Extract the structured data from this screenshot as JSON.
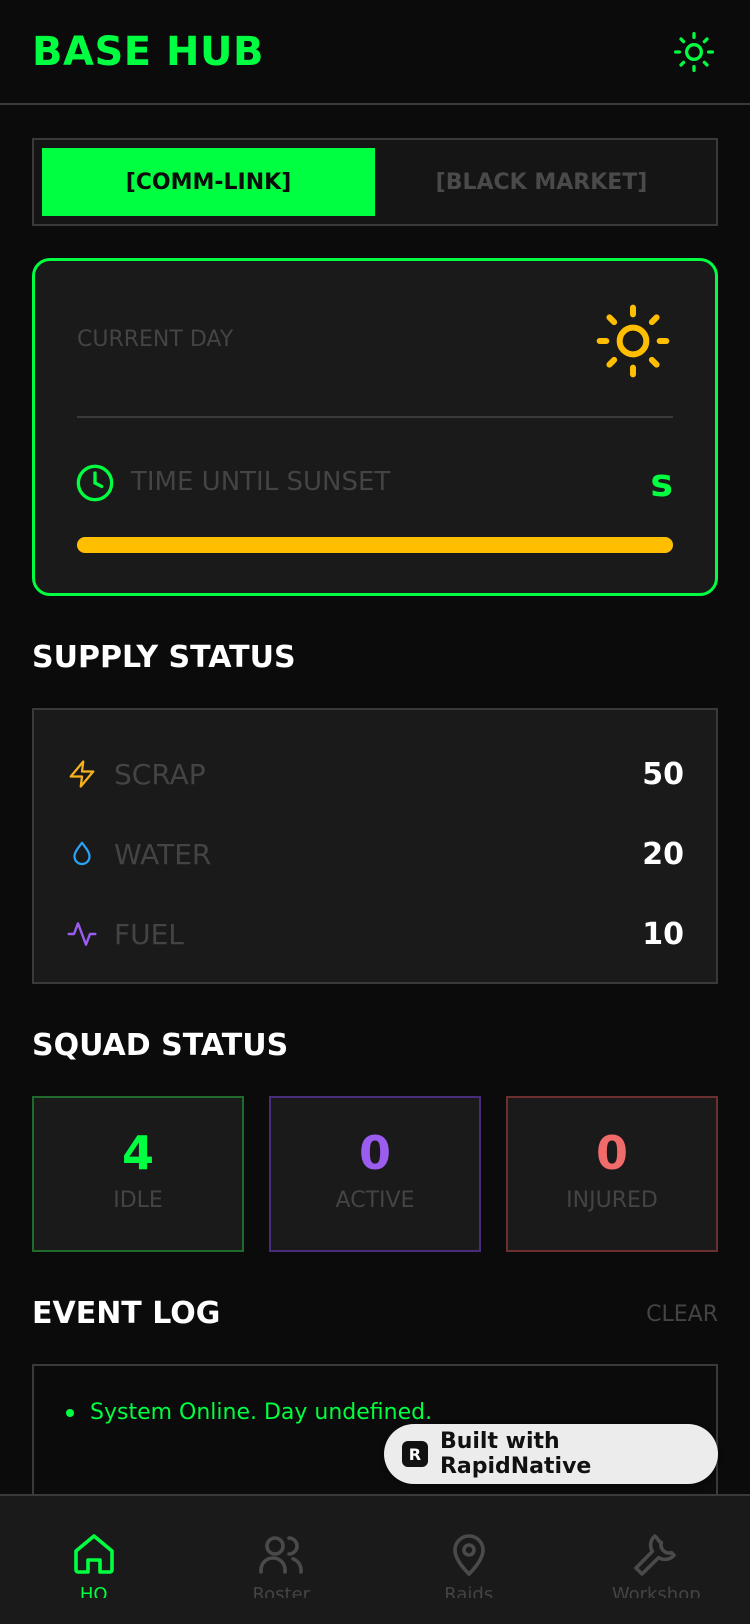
{
  "header": {
    "title": "BASE HUB",
    "theme_icon": "sun-icon"
  },
  "tabs": [
    {
      "label": "[COMM-LINK]",
      "active": true
    },
    {
      "label": "[BLACK MARKET]",
      "active": false
    }
  ],
  "day_card": {
    "current_day_label": "CURRENT DAY",
    "sunset_label": "TIME UNTIL SUNSET",
    "sunset_value": "s",
    "progress_percent": 100
  },
  "supply": {
    "title": "SUPPLY STATUS",
    "items": [
      {
        "label": "SCRAP",
        "value": "50",
        "icon": "lightning-icon",
        "color": "#f5b21b"
      },
      {
        "label": "WATER",
        "value": "20",
        "icon": "droplet-icon",
        "color": "#29a3f5"
      },
      {
        "label": "FUEL",
        "value": "10",
        "icon": "activity-icon",
        "color": "#9b5cf0"
      }
    ]
  },
  "squad": {
    "title": "SQUAD STATUS",
    "items": [
      {
        "value": "4",
        "label": "IDLE",
        "color": "#00ff40",
        "border": "#1f6b2e"
      },
      {
        "value": "0",
        "label": "ACTIVE",
        "color": "#9b5cf0",
        "border": "#4a2d7a"
      },
      {
        "value": "0",
        "label": "INJURED",
        "color": "#f26b6b",
        "border": "#6b2f2f"
      }
    ]
  },
  "event_log": {
    "title": "EVENT LOG",
    "clear_label": "CLEAR",
    "entries": [
      "System Online. Day undefined."
    ]
  },
  "badge": {
    "text": "Built with RapidNative"
  },
  "nav": [
    {
      "label": "HQ",
      "icon": "home-icon",
      "active": true
    },
    {
      "label": "Roster",
      "icon": "users-icon",
      "active": false
    },
    {
      "label": "Raids",
      "icon": "map-pin-icon",
      "active": false
    },
    {
      "label": "Workshop",
      "icon": "wrench-icon",
      "active": false
    }
  ],
  "colors": {
    "accent": "#00ff40",
    "sun": "#ffbf00",
    "background": "#0b0b0b",
    "card": "#1a1a1a"
  }
}
